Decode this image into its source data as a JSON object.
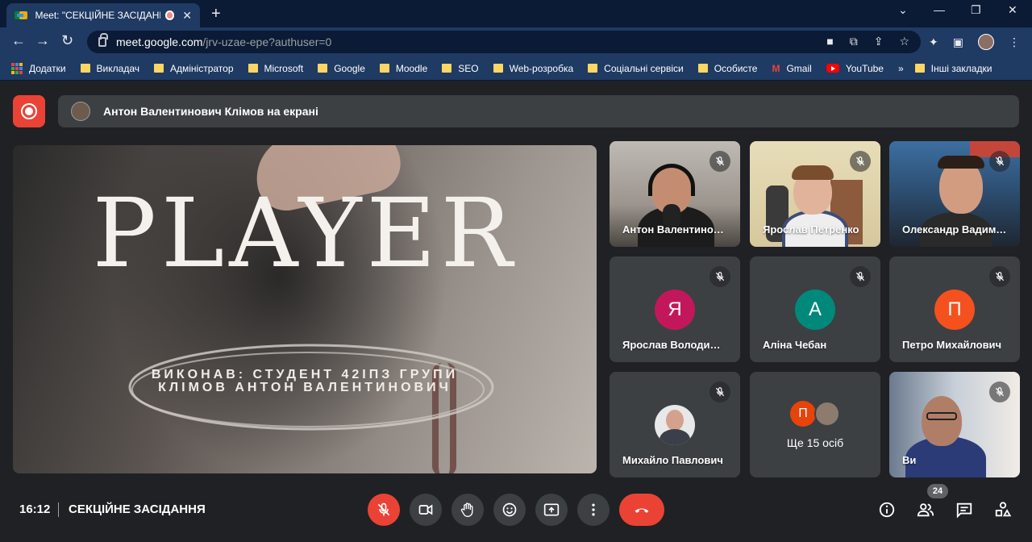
{
  "browser": {
    "tab_title": "Meet: \"СЕКЦІЙНЕ ЗАСІДАНН",
    "url_host": "meet.google.com",
    "url_path": "/jrv-uzae-epe?authuser=0",
    "bookmarks": [
      {
        "label": "Додатки",
        "icon": "apps-icon"
      },
      {
        "label": "Викладач",
        "icon": "folder-icon"
      },
      {
        "label": "Адміністратор",
        "icon": "folder-icon"
      },
      {
        "label": "Microsoft",
        "icon": "folder-icon"
      },
      {
        "label": "Google",
        "icon": "folder-icon"
      },
      {
        "label": "Moodle",
        "icon": "folder-icon"
      },
      {
        "label": "SEO",
        "icon": "folder-icon"
      },
      {
        "label": "Web-розробка",
        "icon": "folder-icon"
      },
      {
        "label": "Соціальні сервіси",
        "icon": "folder-icon"
      },
      {
        "label": "Особисте",
        "icon": "folder-icon"
      },
      {
        "label": "Gmail",
        "icon": "gmail-icon"
      },
      {
        "label": "YouTube",
        "icon": "youtube-icon"
      }
    ],
    "bookmarks_overflow": "»",
    "other_bookmarks": "Інші закладки"
  },
  "meet": {
    "presenting_banner": "Антон Валентинович Клімов на екрані",
    "stage": {
      "title": "PLAYER",
      "subtitle_line1": "ВИКОНАВ: СТУДЕНТ 42ІПЗ ГРУПИ",
      "subtitle_line2": "КЛІМОВ АНТОН ВАЛЕНТИНОВИЧ"
    },
    "participants": [
      {
        "name": "Антон Валентинович Клімов",
        "type": "video"
      },
      {
        "name": "Ярослав Петренко",
        "type": "video"
      },
      {
        "name": "Олександр Вадимович",
        "type": "video"
      },
      {
        "name": "Ярослав Володимирович",
        "type": "letter",
        "letter": "Я",
        "color": "#c2185b"
      },
      {
        "name": "Аліна Чебан",
        "type": "letter",
        "letter": "А",
        "color": "#00897b"
      },
      {
        "name": "Петро Михайлович",
        "type": "letter",
        "letter": "П",
        "color": "#f4511e"
      },
      {
        "name": "Михайло Павлович",
        "type": "photo"
      },
      {
        "name": "Ще 15 осіб",
        "type": "more",
        "letter": "П"
      },
      {
        "name": "Ви",
        "type": "video"
      }
    ],
    "clock": "16:12",
    "meeting_name": "СЕКЦІЙНЕ ЗАСІДАННЯ",
    "participant_count": "24",
    "colors": {
      "accent_red": "#ea4335",
      "tile_bg": "#3c4043",
      "page_bg": "#202124"
    }
  }
}
